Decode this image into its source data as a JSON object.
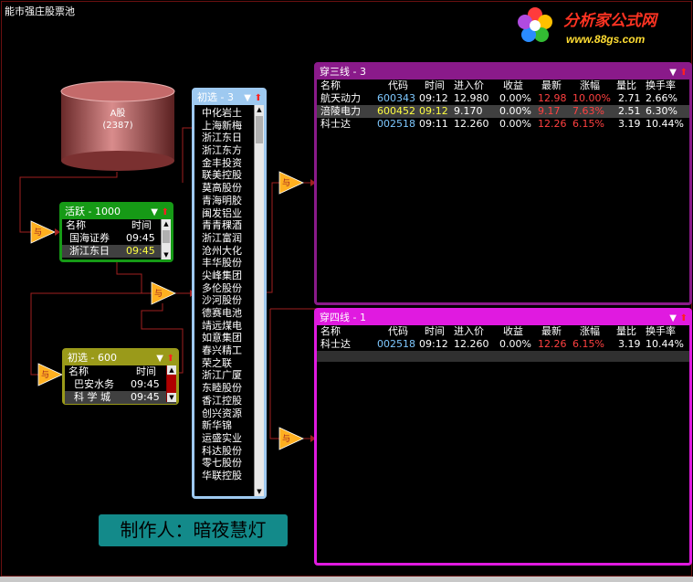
{
  "app": {
    "title": "能市强庄股票池"
  },
  "logo": {
    "name": "分析家公式网",
    "url": "www.88gs.com"
  },
  "database": {
    "label": "A股",
    "count": "(2387)"
  },
  "panels": {
    "huoyue": {
      "title": "活跃 - 1000",
      "headers": [
        "名称",
        "时间"
      ],
      "rows": [
        {
          "name": "国海证券",
          "time": "09:45"
        },
        {
          "name": "浙江东日",
          "time": "09:45"
        }
      ]
    },
    "chuxuan600": {
      "title": "初选 - 600",
      "headers": [
        "名称",
        "时间"
      ],
      "rows": [
        {
          "name": "巴安水务",
          "time": "09:45"
        },
        {
          "name": "科 学 城",
          "time": "09:45"
        }
      ]
    },
    "list": {
      "title": "初选 - 3",
      "items": [
        "中化岩土",
        "上海新梅",
        "浙江东日",
        "浙江东方",
        "金丰投资",
        "联美控股",
        "莫高股份",
        "青海明胶",
        "闽发铝业",
        "青青稞酒",
        "浙江富润",
        "沧州大化",
        "丰华股份",
        "尖峰集团",
        "多伦股份",
        "沙河股份",
        "德赛电池",
        "靖远煤电",
        "如意集团",
        "春兴精工",
        "荣之联",
        "浙江广厦",
        "东睦股份",
        "香江控股",
        "创兴资源",
        "新华锦",
        "运盛实业",
        "科达股份",
        "零七股份",
        "华联控股"
      ]
    },
    "chuansan": {
      "title": "穿三线 - 3",
      "headers": [
        "名称",
        "代码",
        "时间",
        "进入价",
        "收益",
        "最新",
        "涨幅",
        "量比",
        "换手率"
      ],
      "rows": [
        {
          "name": "航天动力",
          "code": "600343",
          "time": "09:12",
          "price": "12.980",
          "gain": "0.00%",
          "last": "12.98",
          "chg": "10.00%",
          "vr": "2.71",
          "turn": "2.66%"
        },
        {
          "name": "涪陵电力",
          "code": "600452",
          "time": "09:12",
          "price": "9.170",
          "gain": "0.00%",
          "last": "9.17",
          "chg": "7.63%",
          "vr": "2.51",
          "turn": "6.30%"
        },
        {
          "name": "科士达",
          "code": "002518",
          "time": "09:11",
          "price": "12.260",
          "gain": "0.00%",
          "last": "12.26",
          "chg": "6.15%",
          "vr": "3.19",
          "turn": "10.44%"
        }
      ]
    },
    "chuansi": {
      "title": "穿四线 - 1",
      "headers": [
        "名称",
        "代码",
        "时间",
        "进入价",
        "收益",
        "最新",
        "涨幅",
        "量比",
        "换手率"
      ],
      "rows": [
        {
          "name": "科士达",
          "code": "002518",
          "time": "09:12",
          "price": "12.260",
          "gain": "0.00%",
          "last": "12.26",
          "chg": "6.15%",
          "vr": "3.19",
          "turn": "10.44%"
        }
      ]
    }
  },
  "gate_label": "与",
  "credit": "制作人：暗夜慧灯",
  "colors": {
    "huoyue": "#169a16",
    "chuxuan": "#9a9a1a",
    "list": "#9ec9f0",
    "chuansan": "#8a1a8a",
    "chuansi": "#e01ae0",
    "wire": "#a02020",
    "gate": "#ffb020"
  }
}
